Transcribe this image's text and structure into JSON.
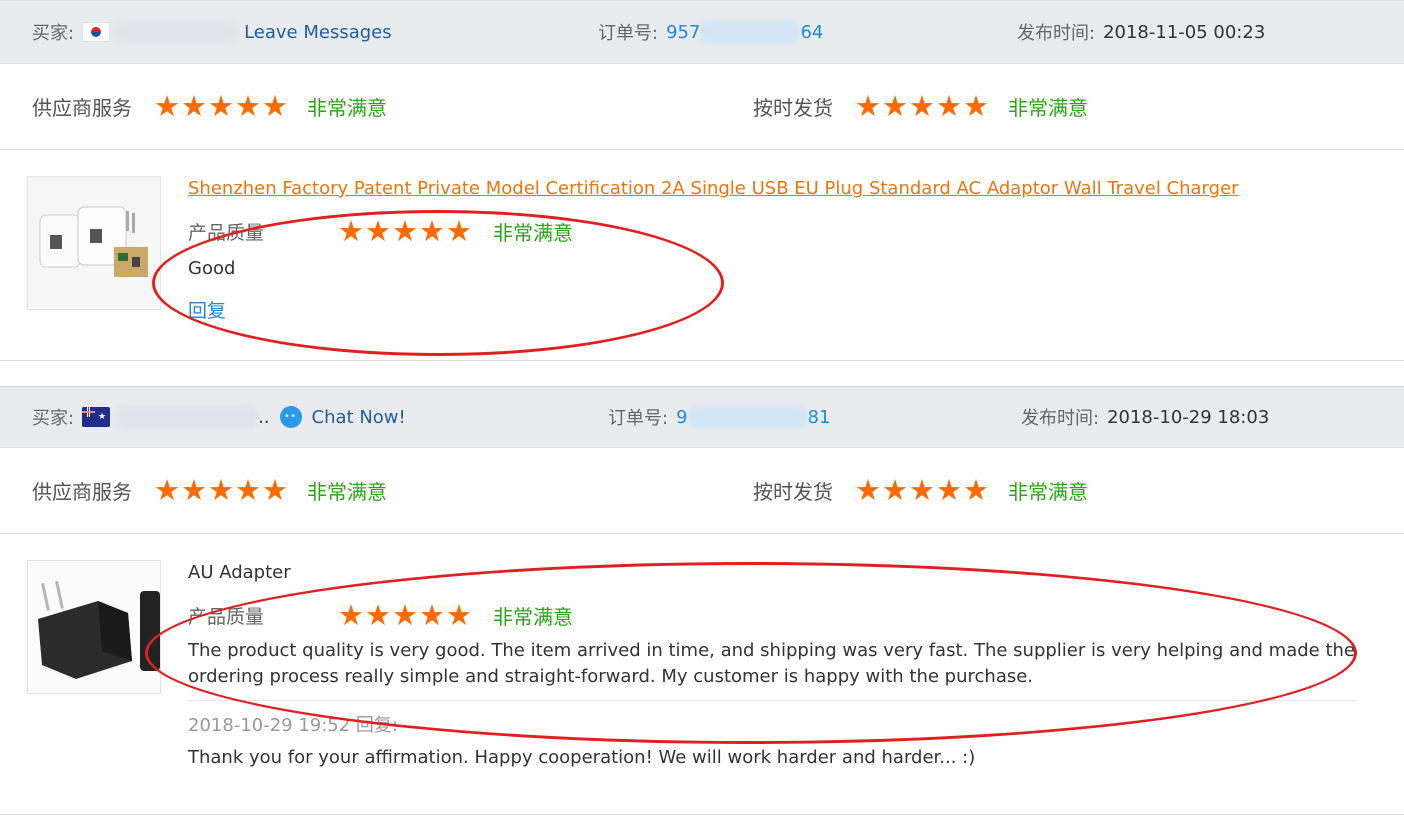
{
  "reviews": [
    {
      "buyer_label": "买家:",
      "flag": "south-korea-flag",
      "contact_link": "Leave Messages",
      "order_label": "订单号:",
      "order_prefix": "957",
      "order_suffix": "64",
      "time_label": "发布时间:",
      "time_value": "2018-11-05 00:23",
      "supplier_service": {
        "label": "供应商服务",
        "stars": 5,
        "status": "非常满意"
      },
      "on_time_shipping": {
        "label": "按时发货",
        "stars": 5,
        "status": "非常满意"
      },
      "product": {
        "title": "Shenzhen Factory Patent Private Model Certification 2A Single USB EU Plug Standard AC Adaptor Wall Travel Charger",
        "quality_label": "产品质量",
        "quality_stars": 5,
        "quality_status": "非常满意",
        "comment": "Good",
        "reply_link": "回复"
      }
    },
    {
      "buyer_label": "买家:",
      "flag": "australia-flag",
      "buyer_suffix": "..",
      "contact_link": "Chat Now!",
      "order_label": "订单号:",
      "order_prefix": "9",
      "order_suffix": "81",
      "time_label": "发布时间:",
      "time_value": "2018-10-29 18:03",
      "supplier_service": {
        "label": "供应商服务",
        "stars": 5,
        "status": "非常满意"
      },
      "on_time_shipping": {
        "label": "按时发货",
        "stars": 5,
        "status": "非常满意"
      },
      "product": {
        "title": "AU Adapter",
        "quality_label": "产品质量",
        "quality_stars": 5,
        "quality_status": "非常满意",
        "comment_line1": "The product quality is very good. The item arrived in time, and shipping was very fast. The supplier is very helping and made the",
        "comment_line2": "ordering process really simple and straight-forward. My customer is happy with the purchase.",
        "reply_meta": "2018-10-29 19:52  回复:",
        "reply_text": "Thank you for your affirmation. Happy cooperation! We will work harder and harder... :)"
      }
    }
  ],
  "star_glyph": "★★★★★",
  "colors": {
    "star": "#ff6a00",
    "satisfied": "#2aa515",
    "link": "#1e88d6",
    "product_link": "#e8760f",
    "annotation": "#e02020"
  }
}
